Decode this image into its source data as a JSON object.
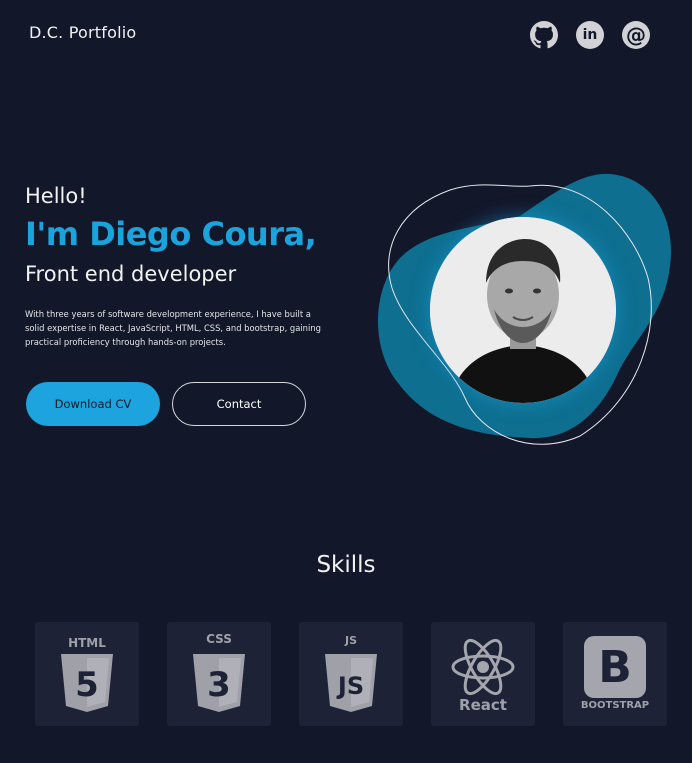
{
  "header": {
    "brand": "D.C. Portfolio",
    "social": [
      {
        "icon": "github-icon"
      },
      {
        "icon": "linkedin-icon",
        "glyph": "in"
      },
      {
        "icon": "email-at-icon",
        "glyph": "@"
      }
    ]
  },
  "hero": {
    "greeting": "Hello!",
    "name": "I'm Diego Coura,",
    "role": "Front end developer",
    "description": "With three years of software development experience, I have built a solid expertise in React, JavaScript, HTML, CSS, and bootstrap, gaining practical proficiency through hands-on projects.",
    "download_label": "Download CV",
    "contact_label": "Contact"
  },
  "skills": {
    "title": "Skills",
    "items": [
      {
        "name": "html5-icon",
        "label": "HTML",
        "glyph": "5"
      },
      {
        "name": "css3-icon",
        "label": "CSS",
        "glyph": "3"
      },
      {
        "name": "javascript-icon",
        "label": "JS",
        "glyph": "JS"
      },
      {
        "name": "react-icon",
        "label": "React"
      },
      {
        "name": "bootstrap-icon",
        "label": "BOOTSTRAP",
        "glyph": "B"
      }
    ]
  },
  "colors": {
    "background": "#13172a",
    "accent": "#1da3dd",
    "card": "#1d2236",
    "blob": "#0e6f91"
  }
}
